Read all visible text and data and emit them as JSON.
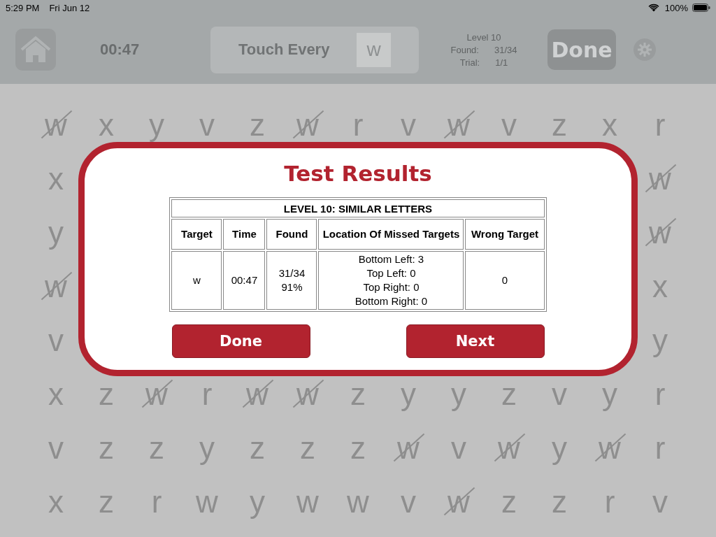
{
  "status_bar": {
    "time": "5:29 PM",
    "date": "Fri Jun 12",
    "battery": "100%"
  },
  "header": {
    "timer": "00:47",
    "prompt": "Touch Every",
    "target": "w",
    "level": "Level 10",
    "found_label": "Found:",
    "found": "31/34",
    "trial_label": "Trial:",
    "trial": "1/1",
    "done_button": "Done"
  },
  "grid": {
    "rows": [
      {
        "cells": [
          {
            "letter": "w",
            "crossed": true
          },
          {
            "letter": "x",
            "crossed": false
          },
          {
            "letter": "y",
            "crossed": false
          },
          {
            "letter": "v",
            "crossed": false
          },
          {
            "letter": "z",
            "crossed": false
          },
          {
            "letter": "w",
            "crossed": true
          },
          {
            "letter": "r",
            "crossed": false
          },
          {
            "letter": "v",
            "crossed": false
          },
          {
            "letter": "w",
            "crossed": true
          },
          {
            "letter": "v",
            "crossed": false
          },
          {
            "letter": "z",
            "crossed": false
          },
          {
            "letter": "x",
            "crossed": false
          },
          {
            "letter": "r",
            "crossed": false
          }
        ]
      },
      {
        "cells": [
          {
            "letter": "x",
            "crossed": false
          },
          {
            "letter": "w",
            "crossed": true
          }
        ]
      },
      {
        "cells": [
          {
            "letter": "y",
            "crossed": false
          },
          {
            "letter": "w",
            "crossed": true
          }
        ]
      },
      {
        "cells": [
          {
            "letter": "w",
            "crossed": true
          },
          {
            "letter": "x",
            "crossed": false
          }
        ]
      },
      {
        "cells": [
          {
            "letter": "v",
            "crossed": false
          },
          {
            "letter": "y",
            "crossed": false
          }
        ]
      },
      {
        "cells": [
          {
            "letter": "x",
            "crossed": false
          },
          {
            "letter": "z",
            "crossed": false
          },
          {
            "letter": "w",
            "crossed": true
          },
          {
            "letter": "r",
            "crossed": false
          },
          {
            "letter": "w",
            "crossed": true
          },
          {
            "letter": "w",
            "crossed": true
          },
          {
            "letter": "z",
            "crossed": false
          },
          {
            "letter": "y",
            "crossed": false
          },
          {
            "letter": "y",
            "crossed": false
          },
          {
            "letter": "z",
            "crossed": false
          },
          {
            "letter": "v",
            "crossed": false
          },
          {
            "letter": "y",
            "crossed": false
          },
          {
            "letter": "r",
            "crossed": false
          }
        ]
      },
      {
        "cells": [
          {
            "letter": "v",
            "crossed": false
          },
          {
            "letter": "z",
            "crossed": false
          },
          {
            "letter": "z",
            "crossed": false
          },
          {
            "letter": "y",
            "crossed": false
          },
          {
            "letter": "z",
            "crossed": false
          },
          {
            "letter": "z",
            "crossed": false
          },
          {
            "letter": "z",
            "crossed": false
          },
          {
            "letter": "w",
            "crossed": true
          },
          {
            "letter": "v",
            "crossed": false
          },
          {
            "letter": "w",
            "crossed": true
          },
          {
            "letter": "y",
            "crossed": false
          },
          {
            "letter": "w",
            "crossed": true
          },
          {
            "letter": "r",
            "crossed": false
          }
        ]
      },
      {
        "cells": [
          {
            "letter": "x",
            "crossed": false
          },
          {
            "letter": "z",
            "crossed": false
          },
          {
            "letter": "r",
            "crossed": false
          },
          {
            "letter": "w",
            "crossed": false
          },
          {
            "letter": "y",
            "crossed": false
          },
          {
            "letter": "w",
            "crossed": false
          },
          {
            "letter": "w",
            "crossed": false
          },
          {
            "letter": "v",
            "crossed": false
          },
          {
            "letter": "w",
            "crossed": true
          },
          {
            "letter": "z",
            "crossed": false
          },
          {
            "letter": "z",
            "crossed": false
          },
          {
            "letter": "r",
            "crossed": false
          },
          {
            "letter": "v",
            "crossed": false
          }
        ]
      }
    ]
  },
  "dialog": {
    "title": "Test Results",
    "table": {
      "caption": "LEVEL 10: SIMILAR LETTERS",
      "columns": [
        "Target",
        "Time",
        "Found",
        "Location Of Missed Targets",
        "Wrong Target"
      ],
      "row": [
        {
          "lines": [
            "w"
          ]
        },
        {
          "lines": [
            "00:47"
          ]
        },
        {
          "lines": [
            "31/34",
            "91%"
          ]
        },
        {
          "lines": [
            "Bottom Left: 3",
            "Top Left: 0",
            "Top Right: 0",
            "Bottom Right: 0"
          ]
        },
        {
          "lines": [
            "0"
          ]
        }
      ]
    },
    "buttons": [
      "Done",
      "Next"
    ]
  }
}
